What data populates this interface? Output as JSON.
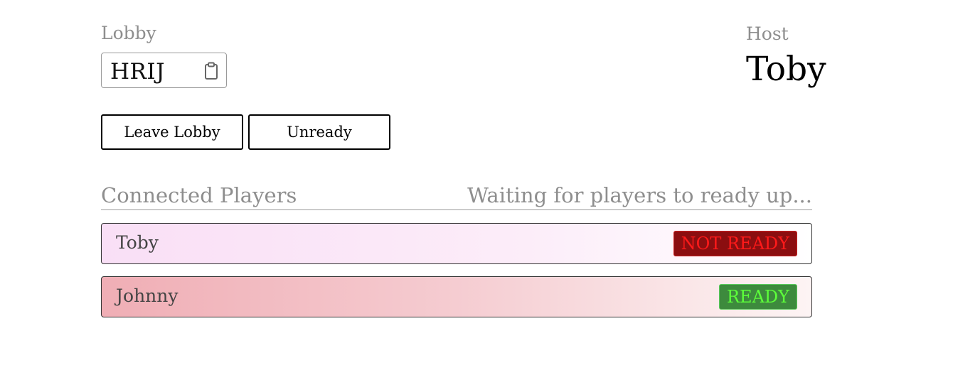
{
  "lobby": {
    "label": "Lobby",
    "code": "HRIJ",
    "copy_icon": "clipboard-icon"
  },
  "host": {
    "label": "Host",
    "name": "Toby"
  },
  "actions": {
    "leave_label": "Leave Lobby",
    "unready_label": "Unready"
  },
  "players": {
    "title": "Connected Players",
    "status": "Waiting for players to ready up...",
    "list": [
      {
        "name": "Toby",
        "state": "NOT READY",
        "state_color": "#ff1a1a",
        "badge_bg": "#8b0e10"
      },
      {
        "name": "Johnny",
        "state": "READY",
        "state_color": "#5dff3a",
        "badge_bg": "#3d8a3d"
      }
    ]
  }
}
